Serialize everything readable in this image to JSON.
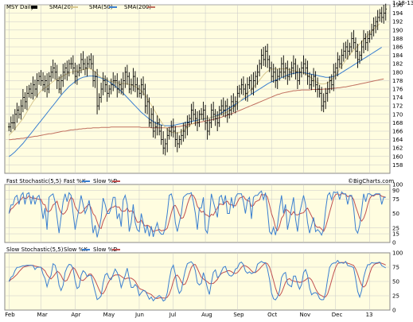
{
  "chart_data": [
    {
      "type": "ohlc",
      "panel": "price",
      "symbol_label": "MSY Daily",
      "date_label": "1-18-13",
      "legend": [
        {
          "name": "SMA(20)",
          "color": "#d8c890"
        },
        {
          "name": "SMA(50)",
          "color": "#3a7fd0"
        },
        {
          "name": "SMA(200)",
          "color": "#c07060"
        }
      ],
      "ylim": [
        156,
        196
      ],
      "y_ticks": [
        158,
        160,
        162,
        164,
        166,
        168,
        170,
        172,
        174,
        176,
        178,
        180,
        182,
        184,
        186,
        188,
        190,
        192,
        194,
        196
      ],
      "x_tick_labels": [
        "Feb",
        "Mar",
        "Apr",
        "May",
        "Jun",
        "Jul",
        "Aug",
        "Sep",
        "Oct",
        "Nov",
        "Dec",
        "13"
      ],
      "grid": true,
      "close_series": [
        167,
        168,
        168,
        170,
        171,
        170,
        172,
        174,
        173,
        175,
        176,
        175,
        177,
        176,
        178,
        179,
        178,
        177,
        178,
        176,
        179,
        180,
        181,
        180,
        178,
        176,
        178,
        180,
        181,
        180,
        182,
        182,
        181,
        179,
        180,
        181,
        183,
        182,
        181,
        182,
        183,
        182,
        178,
        179,
        172,
        174,
        176,
        178,
        177,
        175,
        176,
        177,
        178,
        178,
        176,
        177,
        176,
        178,
        180,
        179,
        176,
        177,
        179,
        177,
        176,
        175,
        177,
        176,
        172,
        173,
        168,
        170,
        166,
        167,
        168,
        166,
        164,
        162,
        163,
        165,
        166,
        167,
        166,
        164,
        163,
        164,
        165,
        166,
        167,
        168,
        169,
        171,
        170,
        169,
        168,
        170,
        170,
        171,
        168,
        166,
        168,
        171,
        170,
        169,
        168,
        171,
        172,
        171,
        172,
        170,
        171,
        173,
        172,
        173,
        175,
        176,
        177,
        176,
        175,
        177,
        178,
        176,
        178,
        179,
        180,
        182,
        184,
        183,
        185,
        183,
        181,
        179,
        180,
        178,
        179,
        180,
        182,
        180,
        181,
        179,
        180,
        181,
        182,
        180,
        178,
        180,
        181,
        182,
        181,
        179,
        177,
        178,
        179,
        177,
        176,
        175,
        172,
        173,
        175,
        176,
        178,
        177,
        180,
        181,
        183,
        182,
        184,
        185,
        186,
        185,
        186,
        188,
        187,
        185,
        183,
        184,
        186,
        188,
        187,
        188,
        189,
        190,
        191,
        192,
        193,
        194,
        193,
        194,
        195
      ],
      "sma20": [
        165,
        165.5,
        166,
        166.6,
        167.2,
        167.8,
        168.4,
        169,
        169.8,
        170.6,
        171.4,
        172.2,
        173,
        173.6,
        174.3,
        175,
        175.6,
        176,
        176.3,
        176.6,
        177,
        177.4,
        177.8,
        178.1,
        178.3,
        178.5,
        178.8,
        179.1,
        179.4,
        179.6,
        179.8,
        180,
        180.1,
        180.2,
        180.3,
        180.4,
        180.5,
        180.6,
        180.7,
        180.8,
        180.9,
        180.7,
        180.4,
        180.1,
        179.6,
        179.1,
        178.8,
        178.6,
        178.4,
        178.2,
        178,
        177.8,
        177.7,
        177.6,
        177.5,
        177.4,
        177.3,
        177.3,
        177.3,
        177.2,
        177.1,
        177,
        176.8,
        176.6,
        176.3,
        176,
        175.6,
        175.1,
        174.5,
        173.8,
        173,
        172.2,
        171.4,
        170.6,
        169.8,
        169,
        168.2,
        167.5,
        166.9,
        166.4,
        166,
        165.8,
        165.7,
        165.6,
        165.6,
        165.7,
        165.9,
        166.2,
        166.5,
        166.8,
        167.2,
        167.6,
        167.9,
        168.2,
        168.4,
        168.6,
        168.8,
        169,
        169.1,
        169.1,
        169.2,
        169.3,
        169.4,
        169.5,
        169.6,
        169.8,
        170,
        170.2,
        170.4,
        170.6,
        170.9,
        171.2,
        171.6,
        172,
        172.5,
        173,
        173.5,
        174,
        174.5,
        175,
        175.5,
        176,
        176.5,
        177,
        177.5,
        178.1,
        178.7,
        179.3,
        179.8,
        180.2,
        180.5,
        180.7,
        180.8,
        180.8,
        180.8,
        180.8,
        180.8,
        180.8,
        180.8,
        180.7,
        180.6,
        180.5,
        180.4,
        180.3,
        180.2,
        180.1,
        180,
        179.8,
        179.6,
        179.3,
        179,
        178.6,
        178.2,
        177.8,
        177.5,
        177.3,
        177.2,
        177.2,
        177.3,
        177.5,
        177.8,
        178.2,
        178.7,
        179.3,
        180,
        180.7,
        181.4,
        182.1,
        182.8,
        183.5,
        184.1,
        184.7,
        185.2,
        185.7,
        186.2,
        186.7,
        187.2,
        187.7,
        188.2,
        188.7,
        189.2,
        189.7,
        190.2,
        190.7,
        191.1,
        191.5
      ],
      "sma50": [
        160,
        160.3,
        160.7,
        161.1,
        161.6,
        162.1,
        162.6,
        163.1,
        163.7,
        164.3,
        164.9,
        165.5,
        166.1,
        166.7,
        167.3,
        167.9,
        168.5,
        169.1,
        169.7,
        170.3,
        170.9,
        171.5,
        172.1,
        172.7,
        173.3,
        173.9,
        174.5,
        175.1,
        175.6,
        176.1,
        176.6,
        177,
        177.4,
        177.8,
        178.1,
        178.4,
        178.6,
        178.8,
        178.9,
        179,
        179.1,
        179.1,
        179.1,
        179,
        178.9,
        178.8,
        178.6,
        178.4,
        178.2,
        178,
        177.7,
        177.4,
        177.1,
        176.7,
        176.3,
        175.9,
        175.5,
        175,
        174.5,
        174,
        173.5,
        173,
        172.5,
        172,
        171.5,
        171,
        170.5,
        170.1,
        169.7,
        169.3,
        168.9,
        168.6,
        168.3,
        168,
        167.8,
        167.6,
        167.5,
        167.4,
        167.3,
        167.3,
        167.3,
        167.3,
        167.4,
        167.5,
        167.6,
        167.7,
        167.8,
        167.9,
        168,
        168.1,
        168.2,
        168.3,
        168.4,
        168.5,
        168.6,
        168.7,
        168.8,
        168.9,
        169,
        169.1,
        169.2,
        169.3,
        169.4,
        169.6,
        169.8,
        170,
        170.3,
        170.6,
        170.9,
        171.2,
        171.5,
        171.8,
        172.1,
        172.4,
        172.7,
        173,
        173.3,
        173.6,
        173.9,
        174.2,
        174.5,
        174.8,
        175.1,
        175.4,
        175.7,
        176,
        176.3,
        176.6,
        176.9,
        177.2,
        177.5,
        177.7,
        177.9,
        178.1,
        178.3,
        178.5,
        178.7,
        178.9,
        179.1,
        179.3,
        179.5,
        179.6,
        179.7,
        179.8,
        179.9,
        179.9,
        179.9,
        179.9,
        179.8,
        179.7,
        179.6,
        179.5,
        179.4,
        179.3,
        179.2,
        179.1,
        179,
        178.9,
        178.8,
        178.8,
        178.8,
        178.9,
        179,
        179.2,
        179.4,
        179.6,
        179.9,
        180.2,
        180.5,
        180.8,
        181.1,
        181.4,
        181.7,
        182,
        182.3,
        182.6,
        182.9,
        183.2,
        183.5,
        183.8,
        184.1,
        184.4,
        184.7,
        185,
        185.3,
        185.6,
        185.9
      ],
      "sma200": [
        164,
        164,
        164.1,
        164.1,
        164.2,
        164.2,
        164.3,
        164.3,
        164.4,
        164.5,
        164.5,
        164.6,
        164.7,
        164.8,
        164.8,
        164.9,
        165,
        165.1,
        165.2,
        165.3,
        165.4,
        165.4,
        165.5,
        165.6,
        165.7,
        165.8,
        165.9,
        166,
        166,
        166.1,
        166.2,
        166.3,
        166.3,
        166.4,
        166.4,
        166.5,
        166.5,
        166.6,
        166.6,
        166.7,
        166.7,
        166.7,
        166.8,
        166.8,
        166.8,
        166.8,
        166.9,
        166.9,
        166.9,
        166.9,
        166.9,
        167,
        167,
        167,
        167,
        167,
        167,
        167,
        167,
        167,
        167,
        167,
        167,
        167,
        167,
        167,
        166.9,
        166.9,
        166.9,
        166.9,
        166.9,
        166.8,
        166.8,
        166.8,
        166.8,
        166.8,
        166.8,
        166.8,
        166.8,
        166.8,
        166.9,
        166.9,
        167,
        167,
        167.1,
        167.1,
        167.2,
        167.3,
        167.4,
        167.5,
        167.6,
        167.7,
        167.8,
        167.9,
        168,
        168.1,
        168.2,
        168.3,
        168.4,
        168.5,
        168.6,
        168.7,
        168.8,
        168.9,
        169,
        169.2,
        169.3,
        169.5,
        169.6,
        169.8,
        170,
        170.1,
        170.3,
        170.5,
        170.7,
        170.9,
        171.1,
        171.3,
        171.5,
        171.7,
        171.9,
        172.1,
        172.3,
        172.5,
        172.7,
        172.9,
        173.1,
        173.3,
        173.5,
        173.7,
        173.9,
        174.1,
        174.3,
        174.5,
        174.7,
        174.8,
        175,
        175.1,
        175.2,
        175.3,
        175.4,
        175.5,
        175.6,
        175.6,
        175.7,
        175.7,
        175.8,
        175.8,
        175.8,
        175.8,
        175.8,
        175.9,
        175.9,
        175.9,
        175.9,
        175.9,
        175.9,
        176,
        176,
        176,
        176.1,
        176.1,
        176.2,
        176.2,
        176.3,
        176.3,
        176.4,
        176.5,
        176.5,
        176.6,
        176.7,
        176.8,
        176.9,
        177,
        177.1,
        177.2,
        177.3,
        177.4,
        177.5,
        177.6,
        177.7,
        177.8,
        177.9,
        178,
        178.1,
        178.2,
        178.3,
        178.4
      ]
    },
    {
      "type": "line",
      "panel": "fast_stochastic",
      "label": "Fast Stochastic(5,5)",
      "legend": [
        {
          "name": "Fast %K",
          "color": "#3a7fd0"
        },
        {
          "name": "Slow %D",
          "color": "#c05050"
        }
      ],
      "watermark": "©BigCharts.com",
      "ylim": [
        0,
        100
      ],
      "y_ticks": [
        0,
        15,
        25,
        50,
        75,
        90,
        100
      ],
      "reference_lines": [
        15,
        25,
        75,
        90
      ]
    },
    {
      "type": "line",
      "panel": "slow_stochastic",
      "label": "Slow Stochastic(5,5)",
      "legend": [
        {
          "name": "Slow %K",
          "color": "#3a7fd0"
        },
        {
          "name": "Slow %D",
          "color": "#c05050"
        }
      ],
      "ylim": [
        0,
        100
      ],
      "y_ticks": [
        0,
        25,
        50,
        75,
        100
      ],
      "reference_lines": [
        25,
        50,
        75
      ]
    }
  ],
  "colors": {
    "panel_bg": "#fffde0",
    "grid": "#c8c8c8",
    "border": "#888888",
    "bar": "#000000",
    "sma20": "#d8c890",
    "sma50": "#3a7fd0",
    "sma200": "#c07060",
    "k_line": "#3a7fd0",
    "d_line": "#c05050"
  }
}
